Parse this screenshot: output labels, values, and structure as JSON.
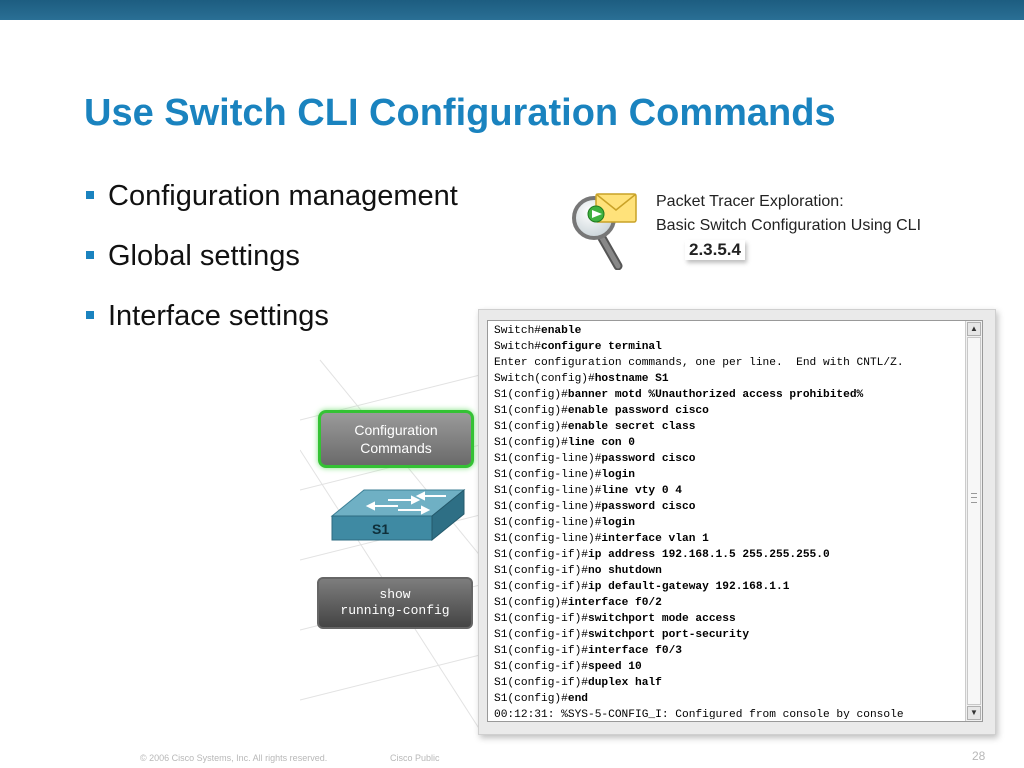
{
  "title": "Use Switch CLI Configuration Commands",
  "bullets": [
    "Configuration management",
    "Global settings",
    "Interface settings"
  ],
  "packet_tracer": {
    "line1": "Packet Tracer Exploration:",
    "line2": "Basic Switch Configuration Using CLI",
    "number": "2.3.5.4",
    "icon": "magnifier-envelope-icon"
  },
  "diagram": {
    "config_label_1": "Configuration",
    "config_label_2": "Commands",
    "switch_label": "S1",
    "show_label_1": "show",
    "show_label_2": "running-config"
  },
  "terminal": {
    "lines": [
      {
        "prompt": "Switch#",
        "cmd": "enable"
      },
      {
        "prompt": "Switch#",
        "cmd": "configure terminal"
      },
      {
        "prompt": "Enter configuration commands, one per line.  End with CNTL/Z.",
        "cmd": ""
      },
      {
        "prompt": "Switch(config)#",
        "cmd": "hostname S1"
      },
      {
        "prompt": "S1(config)#",
        "cmd": "banner motd %Unauthorized access prohibited%"
      },
      {
        "prompt": "S1(config)#",
        "cmd": "enable password cisco"
      },
      {
        "prompt": "S1(config)#",
        "cmd": "enable secret class"
      },
      {
        "prompt": "S1(config)#",
        "cmd": "line con 0"
      },
      {
        "prompt": "S1(config-line)#",
        "cmd": "password cisco"
      },
      {
        "prompt": "S1(config-line)#",
        "cmd": "login"
      },
      {
        "prompt": "S1(config-line)#",
        "cmd": "line vty 0 4"
      },
      {
        "prompt": "S1(config-line)#",
        "cmd": "password cisco"
      },
      {
        "prompt": "S1(config-line)#",
        "cmd": "login"
      },
      {
        "prompt": "S1(config-line)#",
        "cmd": "interface vlan 1"
      },
      {
        "prompt": "S1(config-if)#",
        "cmd": "ip address 192.168.1.5 255.255.255.0"
      },
      {
        "prompt": "S1(config-if)#",
        "cmd": "no shutdown"
      },
      {
        "prompt": "S1(config-if)#",
        "cmd": "ip default-gateway 192.168.1.1"
      },
      {
        "prompt": "S1(config)#",
        "cmd": "interface f0/2"
      },
      {
        "prompt": "S1(config-if)#",
        "cmd": "switchport mode access"
      },
      {
        "prompt": "S1(config-if)#",
        "cmd": "switchport port-security"
      },
      {
        "prompt": "S1(config-if)#",
        "cmd": "interface f0/3"
      },
      {
        "prompt": "S1(config-if)#",
        "cmd": "speed 10"
      },
      {
        "prompt": "S1(config-if)#",
        "cmd": "duplex half"
      },
      {
        "prompt": "S1(config)#",
        "cmd": "end"
      },
      {
        "prompt": "00:12:31: %SYS-5-CONFIG_I: Configured from console by console",
        "cmd": ""
      }
    ]
  },
  "footer": {
    "copyright": "© 2006 Cisco Systems, Inc. All rights reserved.",
    "classification": "Cisco Public",
    "page": "28"
  },
  "colors": {
    "title": "#1a83bf",
    "top_bar": "#1d5d80",
    "highlight_border": "#34c234"
  }
}
